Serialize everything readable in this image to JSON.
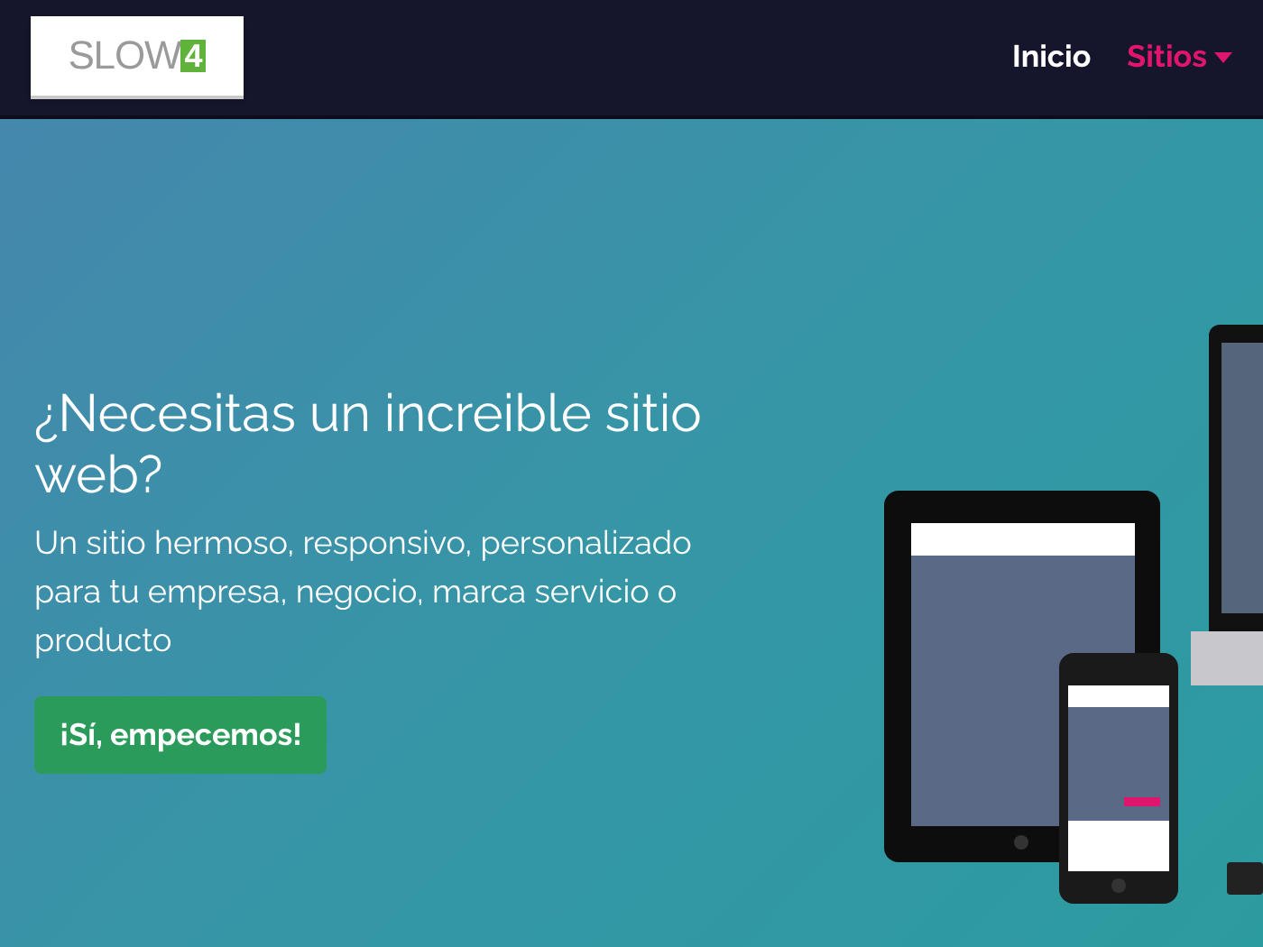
{
  "header": {
    "logo": {
      "word": "SLOW",
      "mark": "4"
    },
    "nav": [
      {
        "label": "Inicio",
        "selected": true,
        "dropdown": false
      },
      {
        "label": "Sitios",
        "selected": false,
        "dropdown": true
      }
    ]
  },
  "hero": {
    "title": "¿Necesitas un increible sitio web?",
    "subtitle": "Un sitio hermoso, responsivo, personalizado para tu empresa, negocio, marca servicio o producto",
    "cta": "¡Sí, empecemos!"
  }
}
